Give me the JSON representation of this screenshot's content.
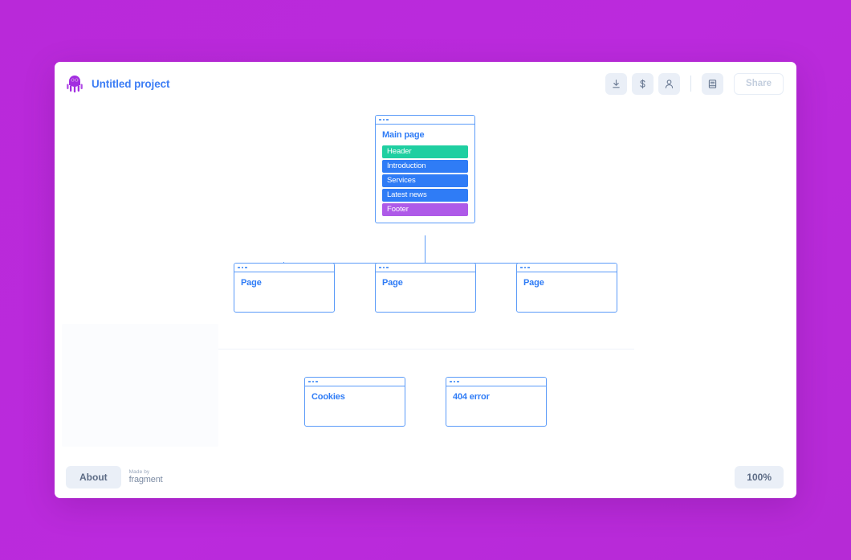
{
  "app": {
    "title": "Untitled project",
    "logo_icon": "octopus-logo",
    "brand_color": "#a22ee0"
  },
  "toolbar": {
    "buttons": [
      {
        "name": "download-button",
        "icon": "download-icon",
        "label": ""
      },
      {
        "name": "pricing-button",
        "icon": "dollar-icon",
        "label": "$"
      },
      {
        "name": "account-button",
        "icon": "person-icon",
        "label": ""
      },
      {
        "name": "docs-button",
        "icon": "book-icon",
        "label": ""
      }
    ],
    "share_label": "Share",
    "share_disabled": true
  },
  "canvas": {
    "root_node": {
      "name": "Main page",
      "blocks": [
        {
          "label": "Header",
          "color": "#1fcfa1"
        },
        {
          "label": "Introduction",
          "color": "#2f7cf6"
        },
        {
          "label": "Services",
          "color": "#2f7cf6"
        },
        {
          "label": "Latest news",
          "color": "#2f7cf6"
        },
        {
          "label": "Footer",
          "color": "#ae5ae8"
        }
      ]
    },
    "child_nodes": [
      {
        "name": "Page"
      },
      {
        "name": "Page"
      },
      {
        "name": "Page"
      }
    ],
    "detached_nodes": [
      {
        "name": "Cookies"
      },
      {
        "name": "404 error"
      }
    ],
    "node_border_color": "#5b9bf8",
    "node_title_color": "#2f7cf6"
  },
  "footer": {
    "about_label": "About",
    "made_by_prefix": "Made by",
    "made_by_brand": "fragment",
    "zoom_level": "100%"
  }
}
